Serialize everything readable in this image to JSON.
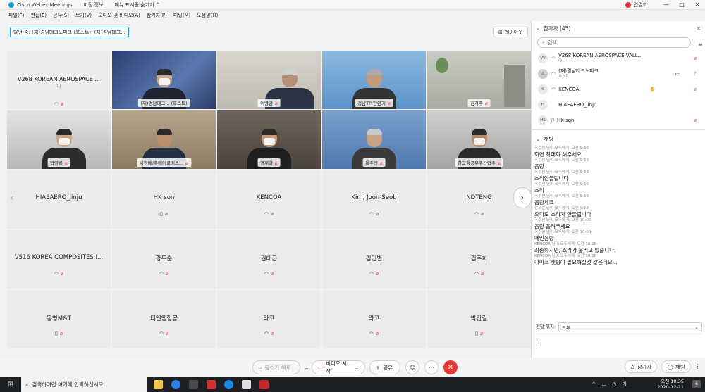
{
  "window": {
    "app_title": "Cisco Webex Meetings",
    "meeting_info": "미팅 정보",
    "hide_menu": "메뉴 표시줄 숨기기 ^",
    "user_name": "연결희",
    "controls": [
      "—",
      "□",
      "✕"
    ]
  },
  "menu": [
    "파일(F)",
    "편집(E)",
    "공유(S)",
    "보기(V)",
    "오디오 및 비디오(A)",
    "참가자(P)",
    "미팅(M)",
    "도움말(H)"
  ],
  "speaking_now": "발언 중: (재)경남테크노파크 (호스트), (재)경남테크...",
  "layout_label": "레이아웃",
  "video_tiles": [
    {
      "name": "V268 KOREAN AEROSPACE ...",
      "sub": "나"
    },
    {
      "name": "(재)경남테크... (호스트)"
    },
    {
      "name": "이병열"
    },
    {
      "name": "경남TP 안완기"
    },
    {
      "name": "김가주"
    },
    {
      "name": "박영룡"
    },
    {
      "name": "서청배/주에어로매스..."
    },
    {
      "name": "명재열"
    },
    {
      "name": "옥주선"
    },
    {
      "name": "한국항공우주산업주"
    }
  ],
  "name_tiles": [
    {
      "name": "HIAEAERO_Jinju"
    },
    {
      "name": "HK son"
    },
    {
      "name": "KENCOA"
    },
    {
      "name": "Kim, Joon-Seob"
    },
    {
      "name": "NDTENG"
    },
    {
      "name": "V516 KOREA COMPOSITES I..."
    },
    {
      "name": "강두순"
    },
    {
      "name": "권대근"
    },
    {
      "name": "김민별"
    },
    {
      "name": "김주희"
    },
    {
      "name": "동영M&T"
    },
    {
      "name": "디엔엠항공"
    },
    {
      "name": "라코"
    },
    {
      "name": "라코"
    },
    {
      "name": "박만길"
    }
  ],
  "toolbar": {
    "mute": "음소거 해제",
    "video": "비디오 시작",
    "share": "공유",
    "participants_btn": "참가자",
    "chat_btn": "채팅"
  },
  "participants": {
    "header": "참가자 (45)",
    "search_placeholder": "검색",
    "list": [
      {
        "initials": "VV",
        "name": "V268 KOREAN AEROSPACE VALL...",
        "sub": "나"
      },
      {
        "initials": "",
        "name": "(재)경남테크노파크",
        "sub": "호스트"
      },
      {
        "initials": "K",
        "name": "KENCOA",
        "sub": ""
      },
      {
        "initials": "H",
        "name": "HIAEAERO_Jinju",
        "sub": ""
      },
      {
        "initials": "HS",
        "name": "HK son",
        "sub": ""
      }
    ]
  },
  "chat": {
    "header": "채팅",
    "messages": [
      {
        "meta": "옥주선 님이 모두에게:   오전 9:59",
        "text": "화면 최대화 해주세요"
      },
      {
        "meta": "옥주선 님이 모두에게:   오전 9:59",
        "text": "음량"
      },
      {
        "meta": "옥주선 님이 모두에게:   오전 9:59",
        "text": "소리안들립니다"
      },
      {
        "meta": "옥주선 님이 모두에게:   오전 9:59",
        "text": "소리"
      },
      {
        "meta": "옥주선 님이 모두에게:   오전 9:59",
        "text": "음량체크"
      },
      {
        "meta": "강두순 님이 모두에게:   오전 9:59",
        "text": "오디오 소리가 안들립니다"
      },
      {
        "meta": "옥주선 님이 모두에게:   오전 10:00",
        "text": "음량 올려주세요"
      },
      {
        "meta": "옥주선 님이 모두에게:   오전 10:00",
        "text": "메인음량"
      },
      {
        "meta": "KENCOA 님이 모두에게:   오전 10:28",
        "text": "죄송하지만, 소리가 울리고 있습니다."
      },
      {
        "meta": "KENCOA 님이 모두에게:   오전 10:28",
        "text": "마이크 셋팅이 필요하실것 같은데요..."
      }
    ],
    "to_label": "전달 위치:",
    "to_value": "모두"
  },
  "taskbar": {
    "search_placeholder": "검색하려면 여기에 입력하십시오.",
    "time": "오전 10:35",
    "date": "2020-12-11",
    "lang": "가",
    "notif": "6"
  }
}
